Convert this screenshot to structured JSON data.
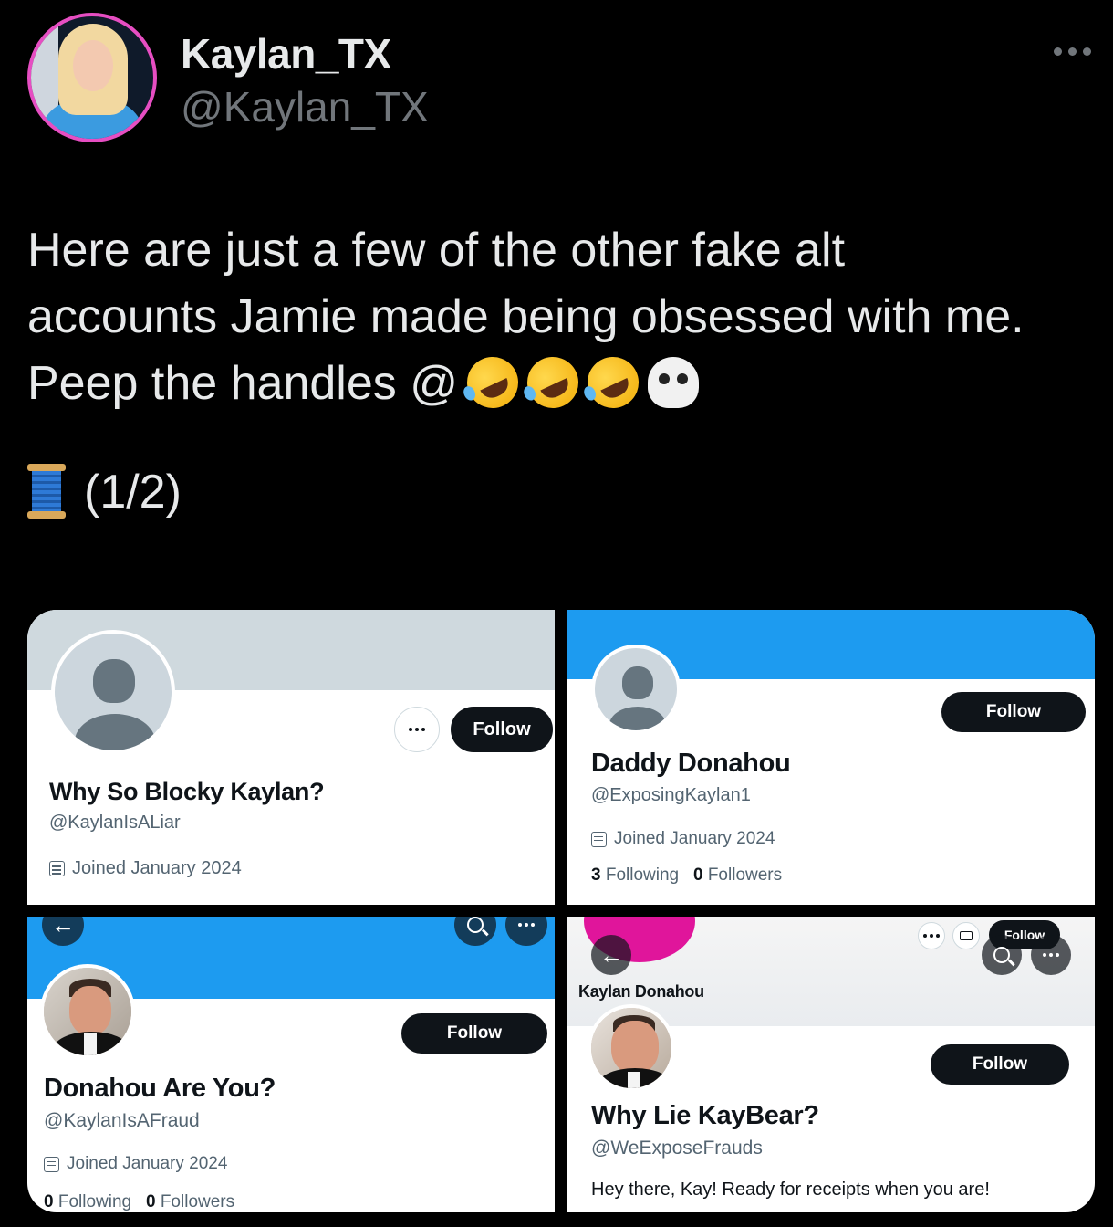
{
  "tweet": {
    "author": {
      "display_name": "Kaylan_TX",
      "handle": "@Kaylan_TX"
    },
    "text_lines": [
      "Here are just a few of the other fake alt",
      "accounts Jamie made being obsessed with me.",
      "Peep the handles @"
    ],
    "emoji_row": [
      "rofl-emoji",
      "rofl-emoji",
      "rofl-emoji",
      "skull-crossbones-emoji"
    ],
    "thread_marker": "(1/2)"
  },
  "screenshots": [
    {
      "name": "Why So Blocky Kaylan?",
      "handle": "@KaylanIsALiar",
      "joined": "Joined January 2024",
      "follow_label": "Follow"
    },
    {
      "name": "Daddy Donahou",
      "handle": "@ExposingKaylan1",
      "joined": "Joined January 2024",
      "following_count": "3",
      "following_label": "Following",
      "followers_count": "0",
      "followers_label": "Followers",
      "follow_label": "Follow"
    },
    {
      "name": "Donahou Are You?",
      "handle": "@KaylanIsAFraud",
      "joined": "Joined January 2024",
      "following_count": "0",
      "following_label": "Following",
      "followers_count": "0",
      "followers_label": "Followers",
      "follow_label": "Follow"
    },
    {
      "overlay_name": "Kaylan Donahou",
      "overlay_follow_label": "Follow",
      "name": "Why Lie KayBear?",
      "handle": "@WeExposeFrauds",
      "bio": "Hey there, Kay! Ready for receipts when you are!",
      "follow_label": "Follow"
    }
  ]
}
